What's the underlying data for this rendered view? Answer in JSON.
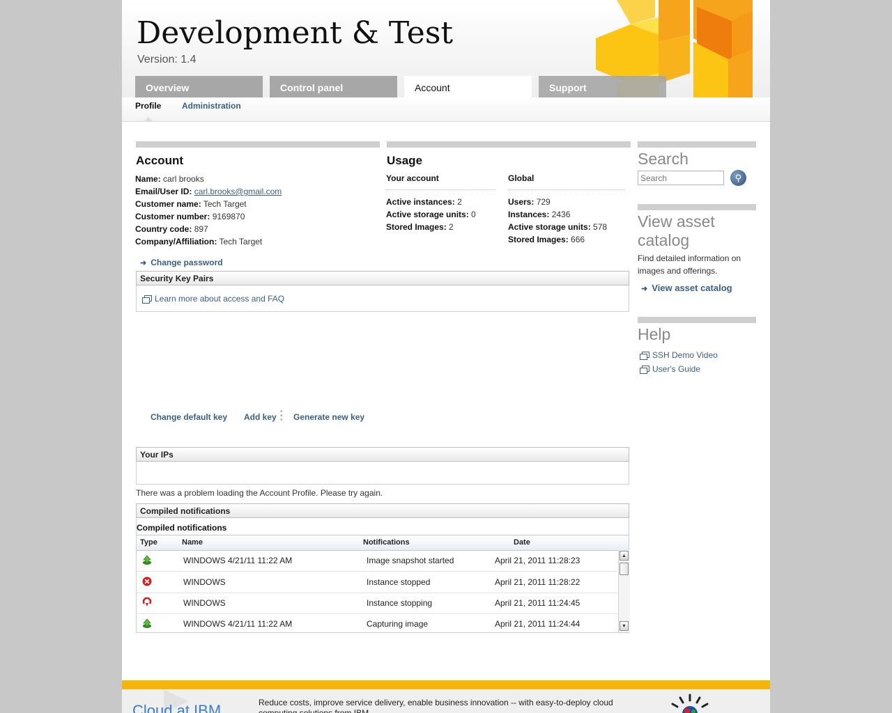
{
  "header": {
    "title": "Development & Test",
    "version": "Version: 1.4"
  },
  "tabs": [
    {
      "label": "Overview"
    },
    {
      "label": "Control panel"
    },
    {
      "label": "Account"
    },
    {
      "label": "Support"
    }
  ],
  "subnav": {
    "profile": "Profile",
    "administration": "Administration"
  },
  "account": {
    "heading": "Account",
    "fields": [
      {
        "label": "Name:",
        "value": "carl brooks"
      },
      {
        "label": "Email/User ID:",
        "value": "carl.brooks@gmail.com"
      },
      {
        "label": "Customer name:",
        "value": "Tech Target"
      },
      {
        "label": "Customer number:",
        "value": "9169870"
      },
      {
        "label": "Country code:",
        "value": "897"
      },
      {
        "label": "Company/Affiliation:",
        "value": "Tech Target"
      }
    ],
    "change_password": "Change password"
  },
  "usage": {
    "heading": "Usage",
    "your_account": {
      "heading": "Your account",
      "fields": [
        {
          "label": "Active instances:",
          "value": "2"
        },
        {
          "label": "Active storage units:",
          "value": "0"
        },
        {
          "label": "Stored Images:",
          "value": "2"
        }
      ]
    },
    "global": {
      "heading": "Global",
      "fields": [
        {
          "label": "Users:",
          "value": "729"
        },
        {
          "label": "Instances:",
          "value": "2436"
        },
        {
          "label": "Active storage units:",
          "value": "578"
        },
        {
          "label": "Stored Images:",
          "value": "666"
        }
      ]
    }
  },
  "security_keys": {
    "heading": "Security Key Pairs",
    "learn_more": "Learn more about access and FAQ",
    "actions": [
      "Change default key",
      "Add key",
      "Generate new key"
    ]
  },
  "your_ips": {
    "heading": "Your IPs",
    "error": "There was a problem loading the Account Profile. Please try again."
  },
  "notifications": {
    "heading": "Compiled notifications",
    "subheading": "Compiled notifications",
    "columns": [
      "Type",
      "Name",
      "Notifications",
      "Date"
    ],
    "rows": [
      {
        "type": "up-arrow-icon",
        "name": "WINDOWS 4/21/11 11:22 AM",
        "notification": "Image snapshot started",
        "date": "April 21, 2011 11:28:23"
      },
      {
        "type": "error-icon",
        "name": "WINDOWS",
        "notification": "Instance stopped",
        "date": "April 21, 2011 11:28:22"
      },
      {
        "type": "stopping-icon",
        "name": "WINDOWS",
        "notification": "Instance stopping",
        "date": "April 21, 2011 11:24:45"
      },
      {
        "type": "up-arrow-icon",
        "name": "WINDOWS 4/21/11 11:22 AM",
        "notification": "Capturing image",
        "date": "April 21, 2011 11:24:44"
      }
    ]
  },
  "sidebar": {
    "search_heading": "Search",
    "search_placeholder": "Search",
    "catalog_heading": "View asset catalog",
    "catalog_text": "Find detailed information on images and offerings.",
    "catalog_link": "View asset catalog",
    "help_heading": "Help",
    "help_links": [
      "SSH Demo Video",
      "User's Guide"
    ]
  },
  "footer": {
    "brand": "Cloud at IBM",
    "tagline": "Reduce costs, improve service delivery, enable business innovation -- with easy-to-deploy cloud computing solutions from IBM."
  },
  "colors": {
    "accent": "#f5b50a",
    "link": "#3b5f83",
    "tab_inactive": "#a7a7a7"
  }
}
